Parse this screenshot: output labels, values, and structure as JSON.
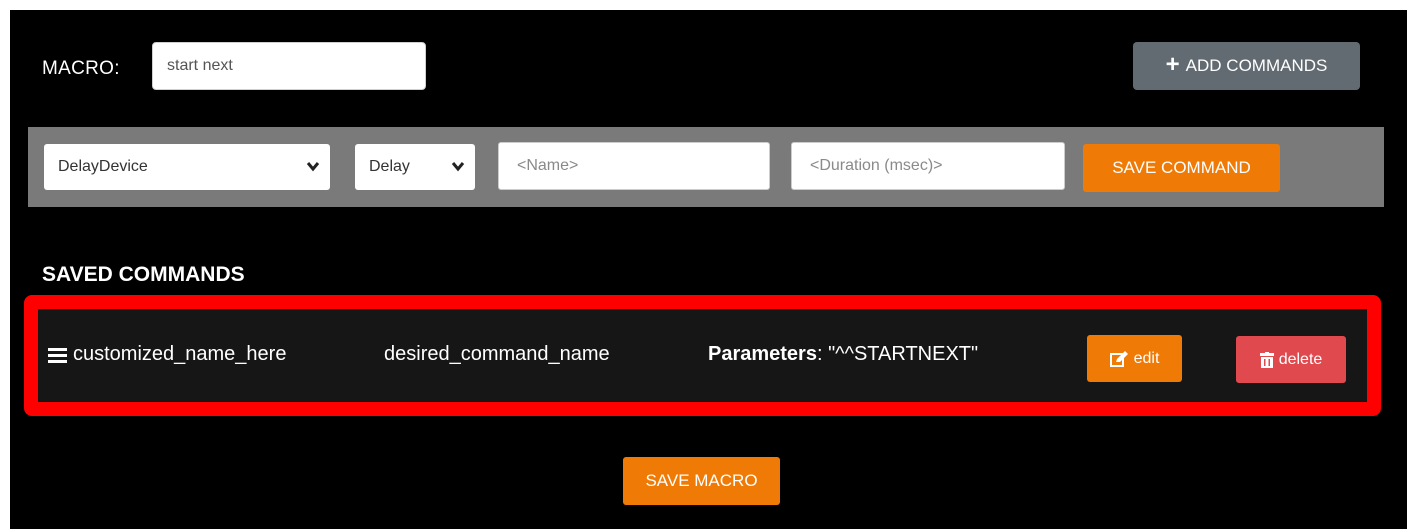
{
  "macro": {
    "label": "MACRO:",
    "name_value": "start next",
    "add_commands_label": "ADD COMMANDS"
  },
  "command_builder": {
    "device_value": "DelayDevice",
    "command_value": "Delay",
    "name_placeholder": "<Name>",
    "duration_placeholder": "<Duration (msec)>",
    "save_command_label": "SAVE COMMAND"
  },
  "saved_commands": {
    "heading": "SAVED COMMANDS",
    "items": [
      {
        "name": "customized_name_here",
        "command": "desired_command_name",
        "parameters_label": "Parameters",
        "parameters_value": ": \"^^STARTNEXT\"",
        "edit_label": "edit",
        "delete_label": "delete"
      }
    ]
  },
  "footer": {
    "save_macro_label": "SAVE MACRO"
  },
  "colors": {
    "background": "#000000",
    "toolbar": "#7a7a7a",
    "secondary_button": "#636b72",
    "accent_orange": "#ef7a05",
    "danger": "#e0494d",
    "highlight": "#ff0000"
  },
  "icons": {
    "add": "plus-icon",
    "select": "chevron-down-icon",
    "drag": "hamburger-icon",
    "edit": "edit-icon",
    "delete": "trash-icon"
  }
}
